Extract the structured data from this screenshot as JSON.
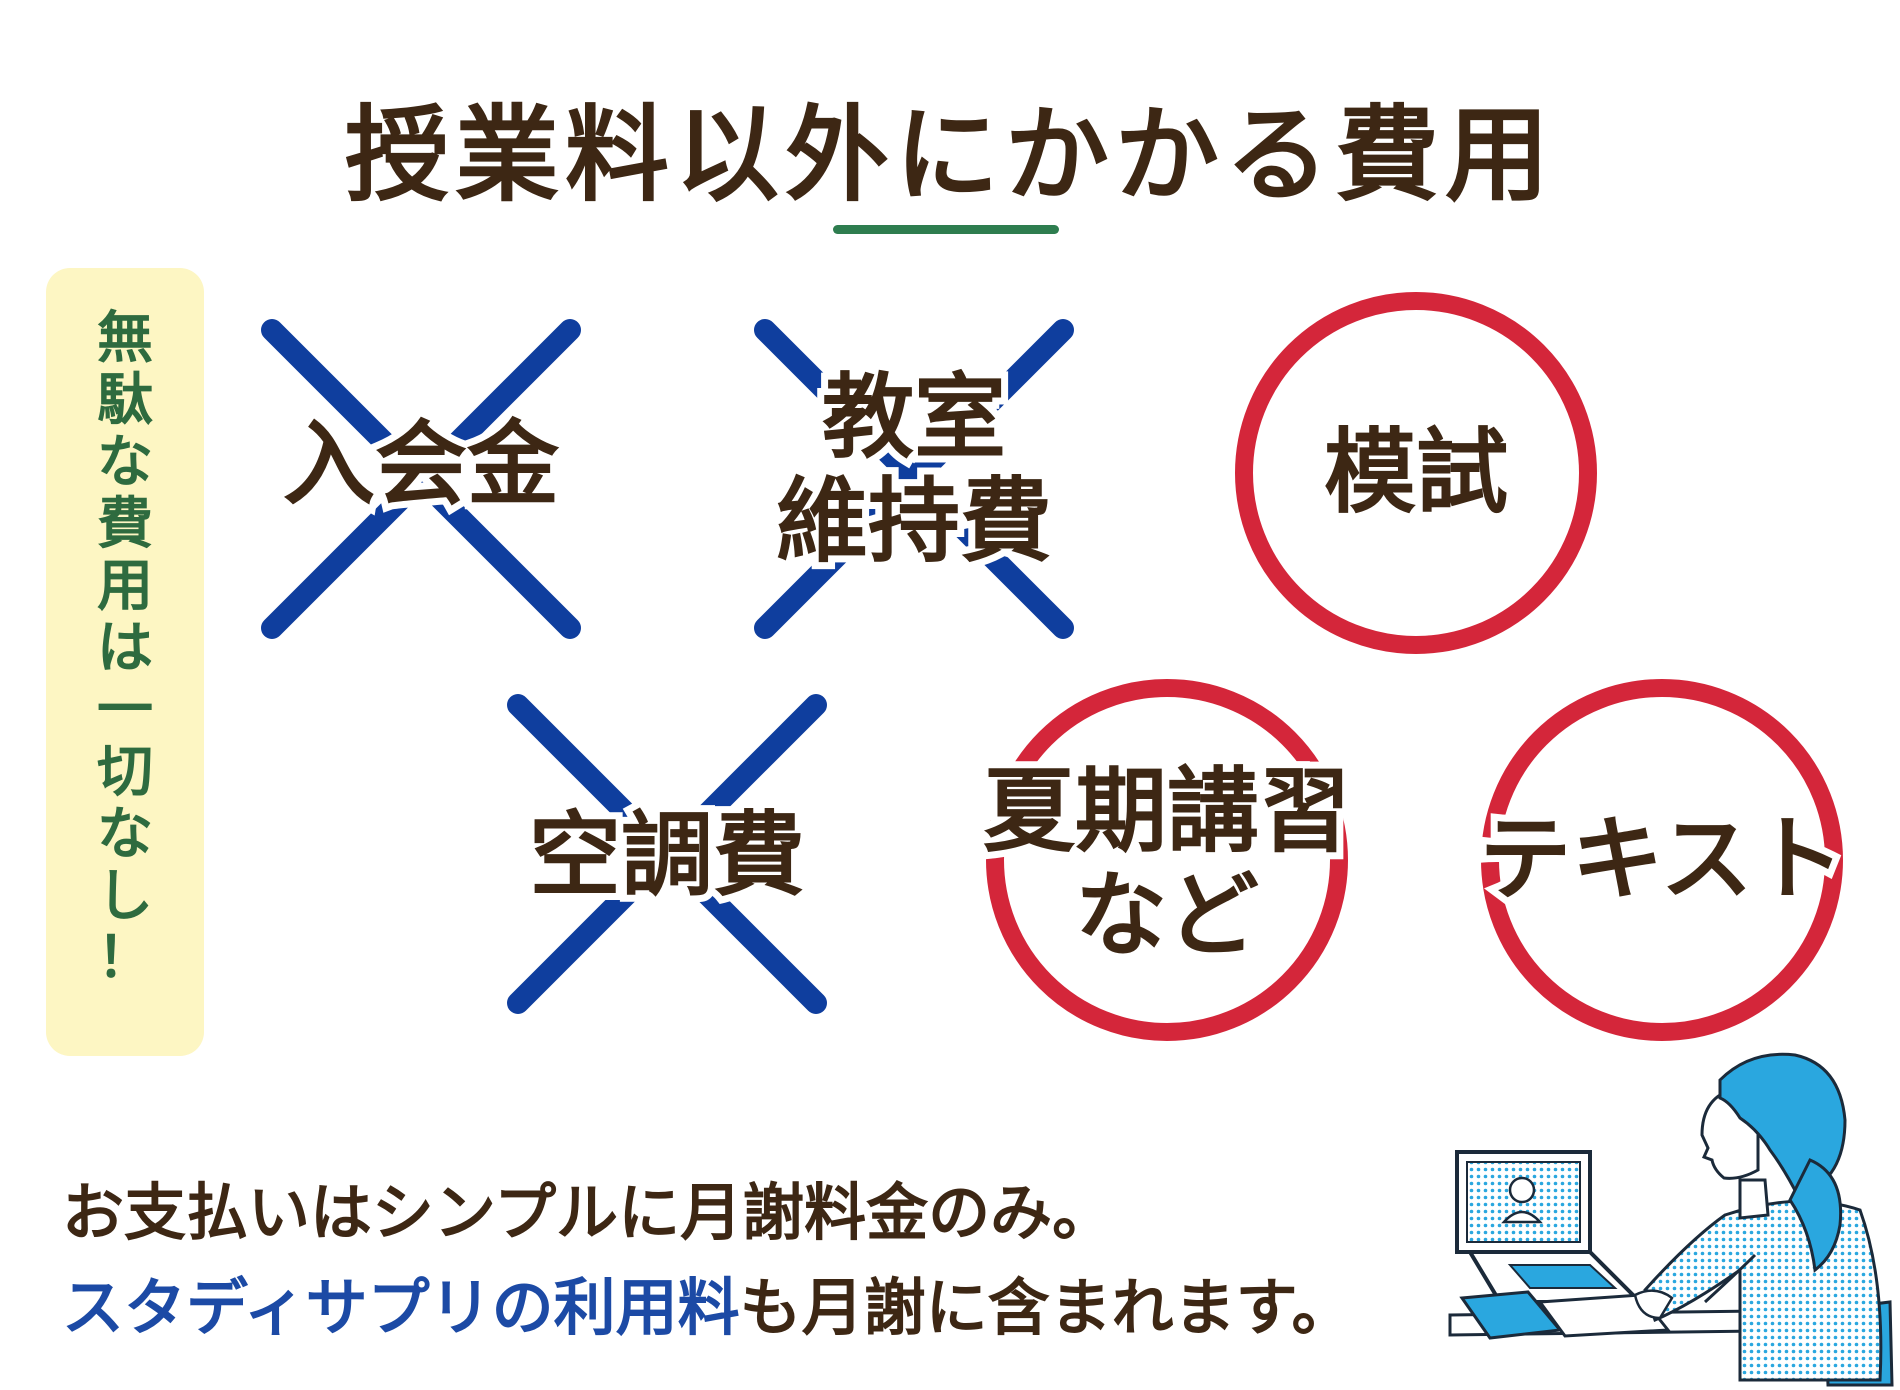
{
  "title": "授業料以外にかかる費用",
  "side_badge": [
    "無",
    "駄",
    "な",
    "費",
    "用",
    "は",
    "一",
    "切",
    "な",
    "し",
    "！"
  ],
  "items": [
    {
      "label_lines": [
        "入会金"
      ],
      "mark": "cross"
    },
    {
      "label_lines": [
        "教室",
        "維持費"
      ],
      "mark": "cross"
    },
    {
      "label_lines": [
        "模試"
      ],
      "mark": "circle"
    },
    {
      "label_lines": [
        "空調費"
      ],
      "mark": "cross"
    },
    {
      "label_lines": [
        "夏期講習",
        "など"
      ],
      "mark": "circle"
    },
    {
      "label_lines": [
        "テキスト"
      ],
      "mark": "circle"
    }
  ],
  "footer": {
    "line1": "お支払いはシンプルに月謝料金のみ。",
    "line2_accent": "スタディサプリの利用料",
    "line2_rest": "も月謝に含まれます。"
  },
  "colors": {
    "text_brown": "#3d2714",
    "underline_green": "#2e7d4f",
    "badge_bg": "#fdf6c3",
    "badge_text": "#2e6b3f",
    "cross_blue": "#0f3e9e",
    "circle_red": "#d4263a",
    "accent_blue": "#1c4aa5",
    "illustration_blue": "#2aa7df"
  },
  "icons": [
    "cross-mark-icon",
    "circle-mark-icon",
    "student-at-laptop-illustration"
  ]
}
